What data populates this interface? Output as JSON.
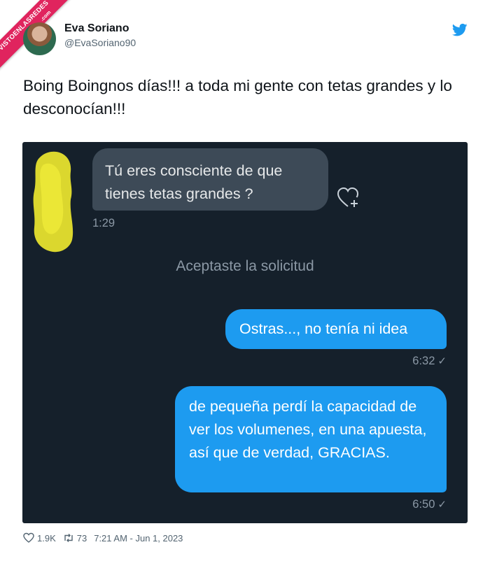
{
  "watermark": {
    "line1": "VISTOENLASREDES",
    "line2": ".com",
    "color": "#e0245e"
  },
  "author": {
    "name": "Eva Soriano",
    "handle": "@EvaSoriano90"
  },
  "icons": {
    "brand": "twitter-bird-icon",
    "like": "heart-icon",
    "retweet": "retweet-icon",
    "react": "heart-plus-icon"
  },
  "tweet": {
    "text": "Boing Boingnos días!!! a toda mi gente con tetas grandes y lo desconocían!!!"
  },
  "conversation": {
    "incoming": {
      "text": "Tú eres consciente de que tienes tetas grandes ?",
      "time": "1:29"
    },
    "notice": "Aceptaste la solicitud",
    "outgoing": [
      {
        "text": "Ostras..., no tenía ni idea",
        "time": "6:32",
        "status": "✓"
      },
      {
        "text": "de pequeña perdí la capacidad de ver los volumenes, en una apuesta, así que de verdad, GRACIAS.",
        "time": "6:50",
        "status": "✓"
      }
    ],
    "colors": {
      "background": "#15202b",
      "incoming_bubble": "#3d4a57",
      "outgoing_bubble": "#1d9bf0"
    }
  },
  "stats": {
    "likes": "1.9K",
    "retweets": "73",
    "timestamp": "7:21 AM - Jun 1, 2023"
  }
}
